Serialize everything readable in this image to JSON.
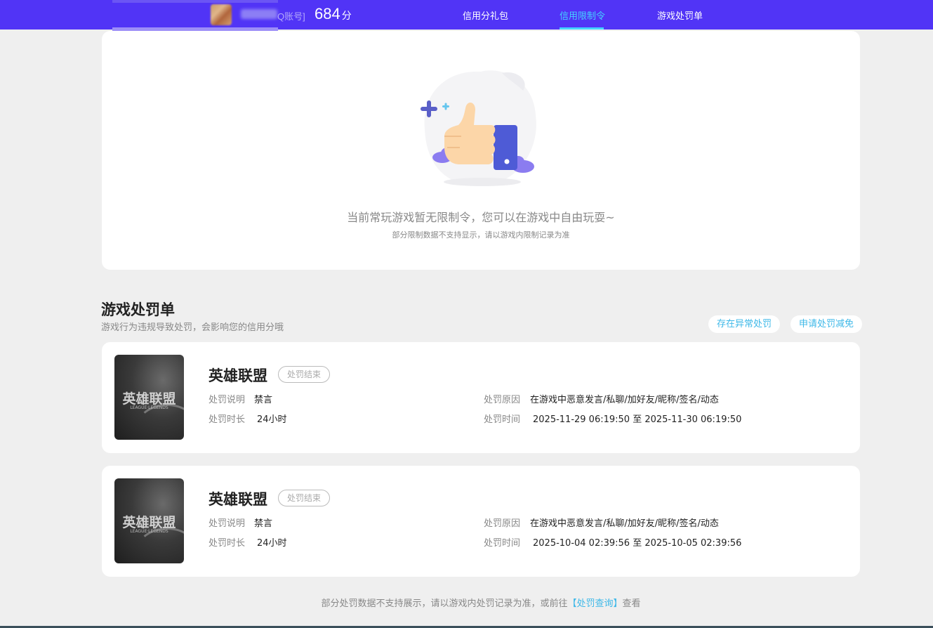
{
  "topbar": {
    "account_tag": "Q账号]",
    "score": "684",
    "score_unit": "分",
    "nav": [
      {
        "label": "信用分礼包",
        "active": false
      },
      {
        "label": "信用限制令",
        "active": true
      },
      {
        "label": "游戏处罚单",
        "active": false
      }
    ]
  },
  "empty_state": {
    "icon": "thumbs-up-illustration",
    "message": "当前常玩游戏暂无限制令，您可以在游戏中自由玩耍~",
    "note": "部分限制数据不支持显示，请以游戏内限制记录为准"
  },
  "penalty_section": {
    "title": "游戏处罚单",
    "subtitle": "游戏行为违规导致处罚，会影响您的信用分哦",
    "btn_abnormal": "存在异常处罚",
    "btn_reduce": "申请处罚减免"
  },
  "penalties": [
    {
      "game": "英雄联盟",
      "cover_title": "英雄联盟",
      "cover_sub": "LEAGUE·LEGENDS",
      "status": "处罚结束",
      "desc_label": "处罚说明",
      "desc": "禁言",
      "duration_label": "处罚时长",
      "duration": "24小时",
      "reason_label": "处罚原因",
      "reason": "在游戏中恶意发言/私聊/加好友/昵称/签名/动态",
      "time_label": "处罚时间",
      "time": "2025-11-29 06:19:50 至 2025-11-30 06:19:50"
    },
    {
      "game": "英雄联盟",
      "cover_title": "英雄联盟",
      "cover_sub": "LEAGUE·LEGENDS",
      "status": "处罚结束",
      "desc_label": "处罚说明",
      "desc": "禁言",
      "duration_label": "处罚时长",
      "duration": "24小时",
      "reason_label": "处罚原因",
      "reason": "在游戏中恶意发言/私聊/加好友/昵称/签名/动态",
      "time_label": "处罚时间",
      "time": "2025-10-04 02:39:56 至 2025-10-05 02:39:56"
    }
  ],
  "footer": {
    "text": "部分处罚数据不支持展示，请以游戏内处罚记录为准，或前往",
    "link": "【处罚查询】",
    "suffix": "查看"
  },
  "colors": {
    "topbar": "#5134f6",
    "accent": "#44d2ff",
    "link": "#3db8e8"
  }
}
